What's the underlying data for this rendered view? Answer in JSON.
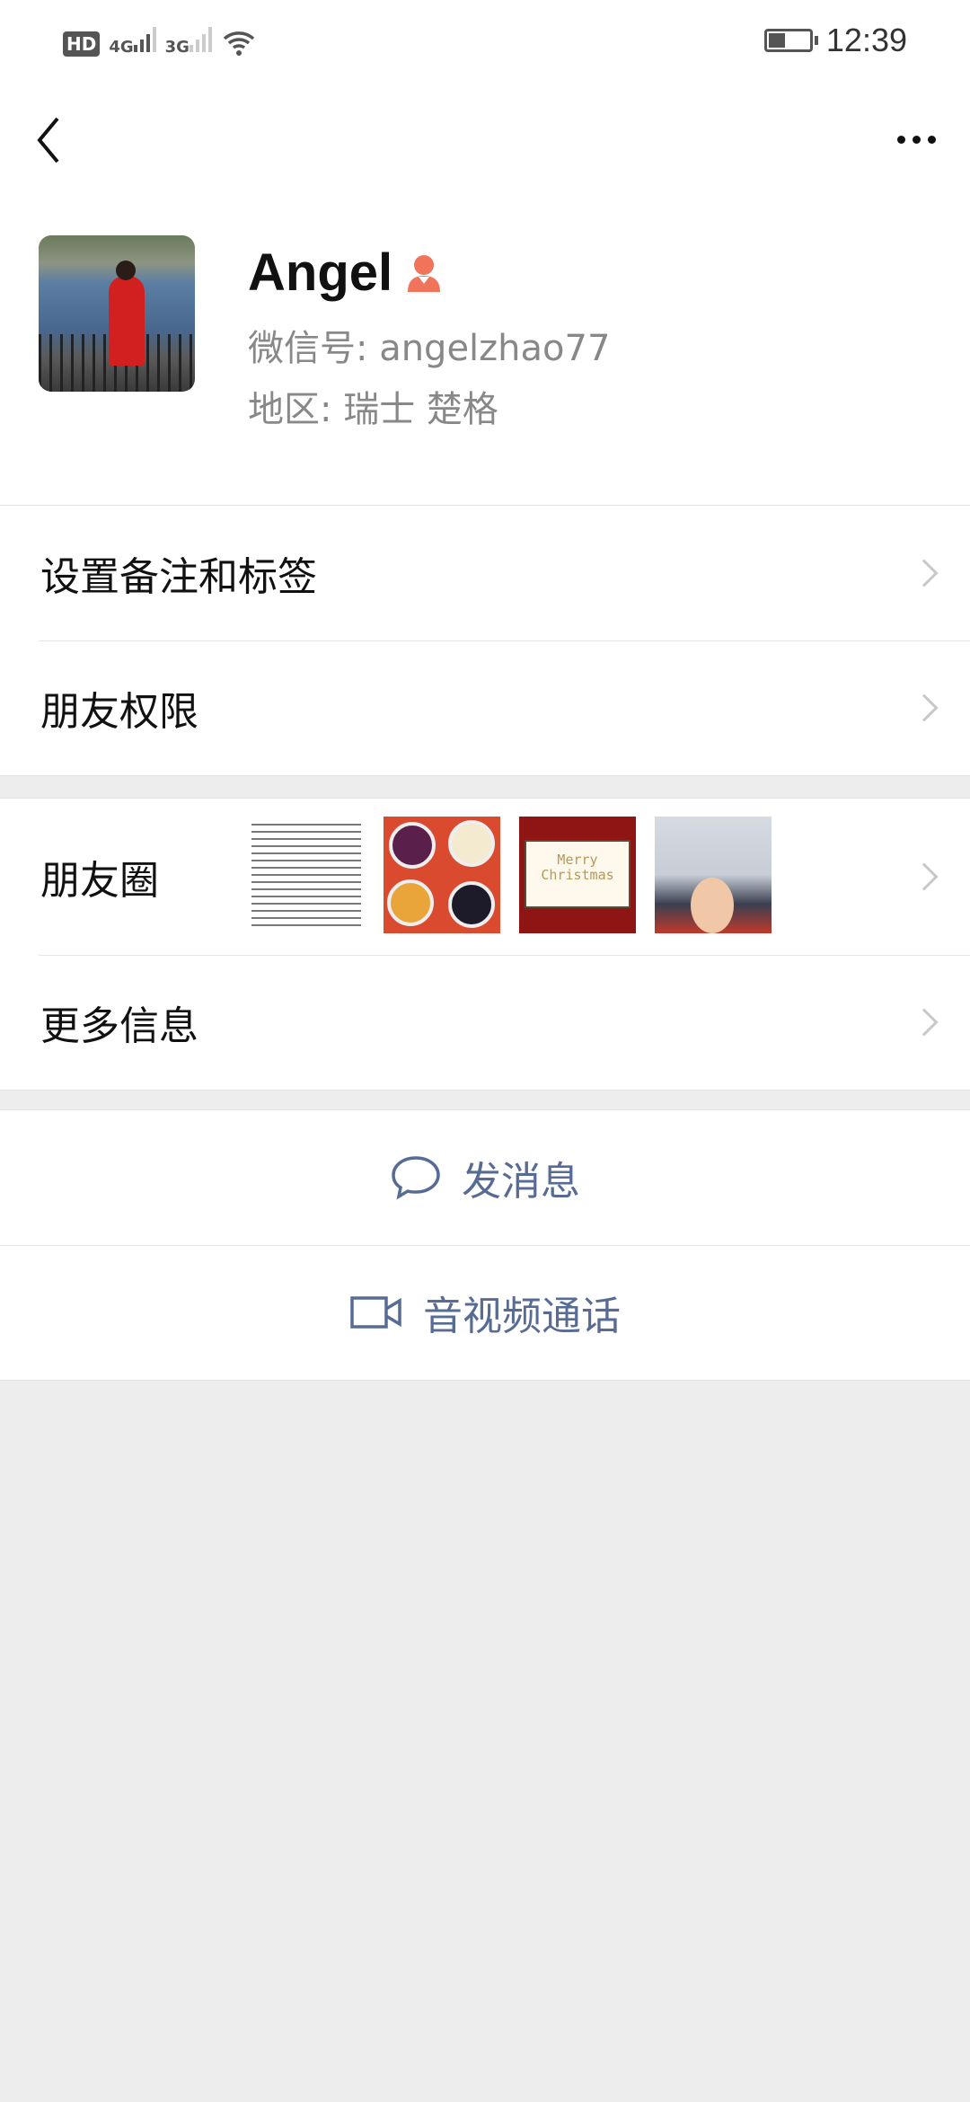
{
  "status_bar": {
    "hd": "HD",
    "sim1": "4G",
    "sim2": "3G",
    "time": "12:39",
    "icons": [
      "hd-icon",
      "signal-4g-icon",
      "signal-3g-icon",
      "wifi-icon",
      "battery-icon"
    ]
  },
  "nav": {
    "back_icon": "chevron-left-icon",
    "more_icon": "more-dots-icon"
  },
  "profile": {
    "name": "Angel",
    "gender_icon": "female-icon",
    "gender_color": "#f0735a",
    "wechat_id_label": "微信号: angelzhao77",
    "region_label": "地区: 瑞士  楚格"
  },
  "menu": [
    {
      "label": "设置备注和标签"
    },
    {
      "label": "朋友权限"
    }
  ],
  "moments": {
    "label": "朋友圈",
    "thumb3_text": "Merry Christmas"
  },
  "more_info": {
    "label": "更多信息"
  },
  "actions": [
    {
      "label": "发消息",
      "icon": "chat-bubble-icon"
    },
    {
      "label": "音视频通话",
      "icon": "video-call-icon"
    }
  ],
  "colors": {
    "link": "#576b95",
    "background": "#ededed"
  }
}
